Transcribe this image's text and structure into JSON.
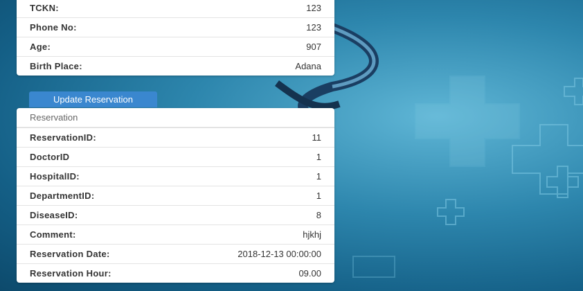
{
  "patient": {
    "rows": [
      {
        "label": "TCKN:",
        "value": "123"
      },
      {
        "label": "Phone No:",
        "value": "123"
      },
      {
        "label": "Age:",
        "value": "907"
      },
      {
        "label": "Birth Place:",
        "value": "Adana"
      }
    ]
  },
  "update_button_label": "Update Reservation",
  "reservation": {
    "heading": "Reservation",
    "rows": [
      {
        "label": "ReservationID:",
        "value": "11"
      },
      {
        "label": "DoctorID",
        "value": "1"
      },
      {
        "label": "HospitalID:",
        "value": "1"
      },
      {
        "label": "DepartmentID:",
        "value": "1"
      },
      {
        "label": "DiseaseID:",
        "value": "8"
      },
      {
        "label": "Comment:",
        "value": "hjkhj"
      },
      {
        "label": "Reservation Date:",
        "value": "2018-12-13 00:00:00"
      },
      {
        "label": "Reservation Hour:",
        "value": "09.00"
      }
    ]
  },
  "colors": {
    "button": "#3a87cf",
    "background": "#2d86ad"
  },
  "icons": [
    "caduceus-decoration",
    "medical-cross-decoration"
  ]
}
